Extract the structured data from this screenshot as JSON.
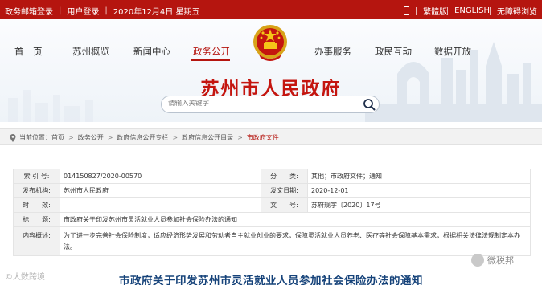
{
  "topbar": {
    "left_items": [
      "政务邮箱登录",
      "用户登录",
      "2020年12月4日 星期五"
    ],
    "right_items": [
      "繁體版",
      "ENGLISH",
      "无障碍浏览"
    ]
  },
  "nav": {
    "items": [
      "首　页",
      "苏州概览",
      "新闻中心",
      "政务公开",
      "办事服务",
      "政民互动",
      "数据开放"
    ],
    "active": "政务公开"
  },
  "site": {
    "title": "苏州市人民政府",
    "url_part1": "www",
    "url_dot1": ".",
    "url_part2": "suzhou",
    "url_dot2": ".",
    "url_part3": "gov",
    "url_dot3": ".",
    "url_part4": "cn"
  },
  "search": {
    "placeholder": "请输入关键字",
    "icon": "search-icon"
  },
  "breadcrumb": {
    "label": "当前位置：",
    "items": [
      "首页",
      "政务公开",
      "政府信息公开专栏",
      "政府信息公开目录"
    ],
    "current": "市政府文件"
  },
  "info": {
    "index_label": "索 引 号:",
    "index_value": "014150827/2020-00570",
    "category_label": "分　　类:",
    "category_value": "其他；市政府文件；通知",
    "issuer_label": "发布机构:",
    "issuer_value": "苏州市人民政府",
    "date_label": "发文日期:",
    "date_value": "2020-12-01",
    "validity_label": "时　　效:",
    "validity_value": "",
    "docno_label": "文　　号:",
    "docno_value": "苏府规字〔2020〕17号",
    "title_label": "标　　题:",
    "title_value": "市政府关于印发苏州市灵活就业人员参加社会保险办法的通知",
    "summary_label": "内容概述:",
    "summary_value": "为了进一步完善社会保险制度，适应经济形势发展和劳动者自主就业创业的要求，保障灵活就业人员养老、医疗等社会保障基本需求，根据相关法律法规制定本办法。"
  },
  "article": {
    "title": "市政府关于印发苏州市灵活就业人员参加社会保险办法的通知"
  },
  "watermarks": {
    "left": "©大数跨境",
    "right": "微税邦"
  },
  "colors": {
    "brand_red": "#b5150f",
    "title_red": "#c4150f",
    "article_blue": "#16437a"
  }
}
